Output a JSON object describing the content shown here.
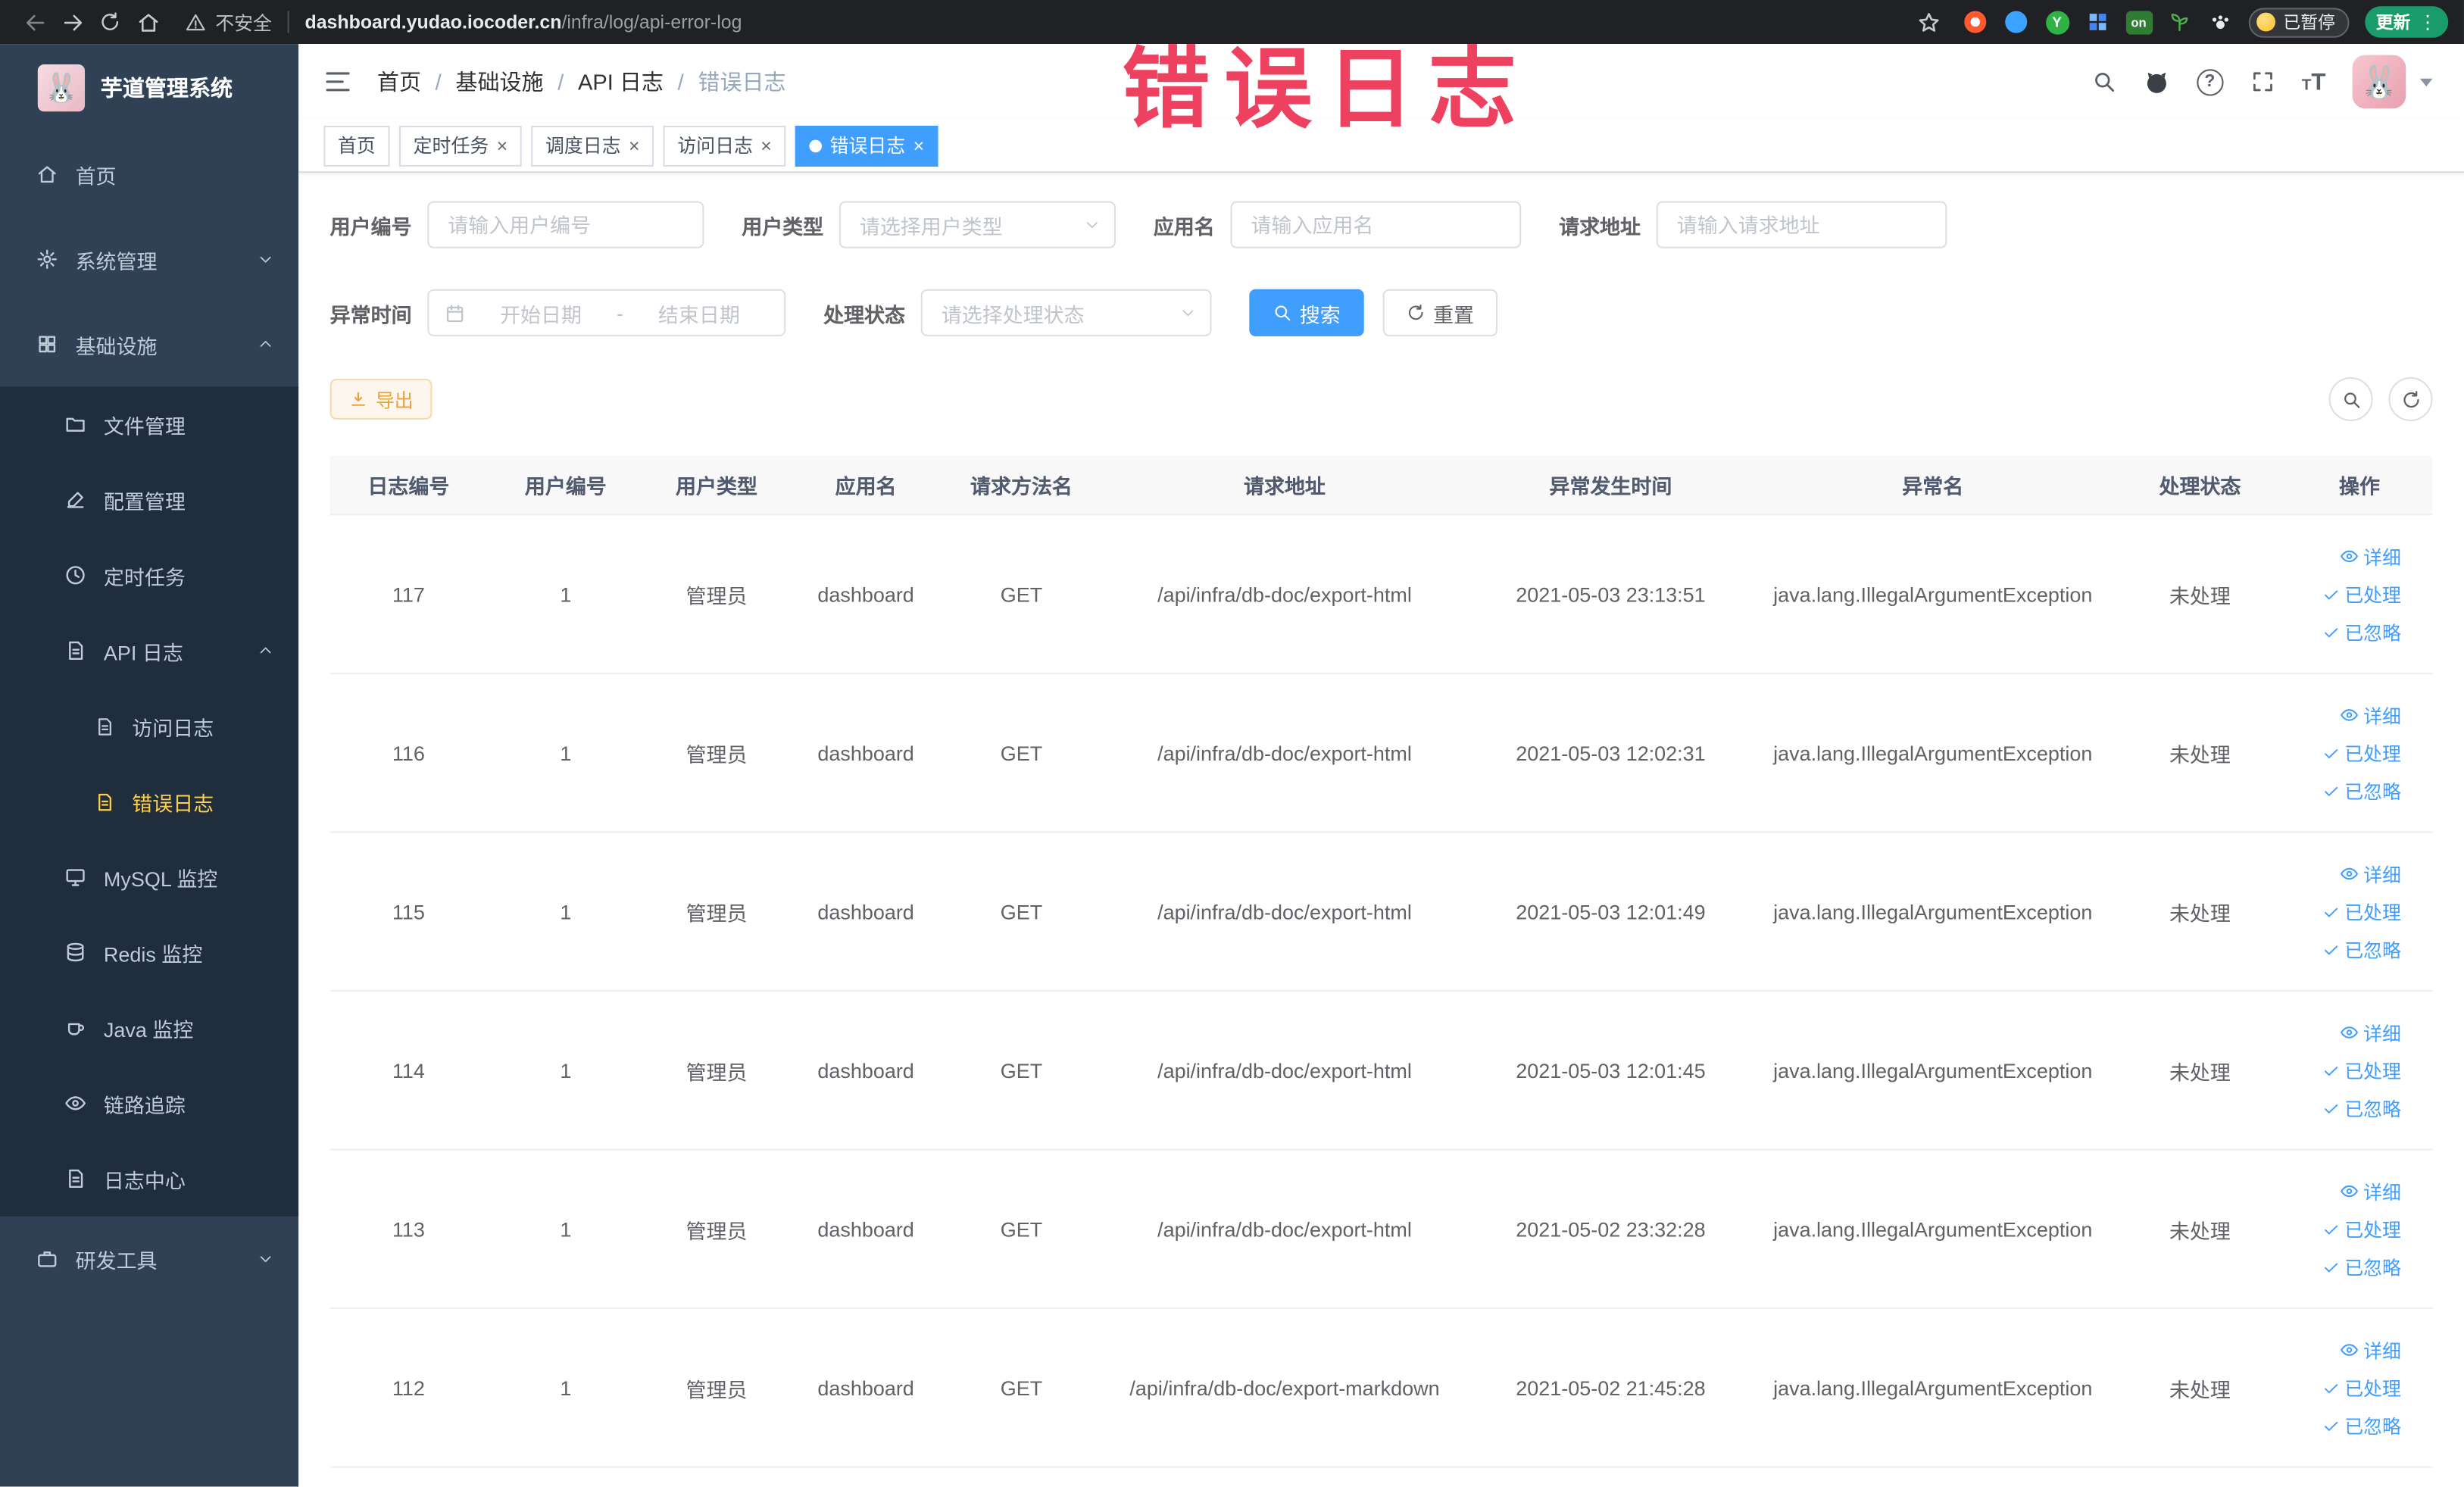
{
  "browser": {
    "security_label": "不安全",
    "url_host": "dashboard.yudao.iocoder.cn",
    "url_path": "/infra/log/api-error-log",
    "extension_y_badge": "Y",
    "extension_on_badge": "on",
    "paused_chip": "已暂停",
    "update_button": "更新"
  },
  "annotation": {
    "text": "错误日志",
    "color": "#ee4160"
  },
  "sidebar": {
    "title": "芋道管理系统",
    "items": [
      {
        "label": "首页"
      },
      {
        "label": "系统管理"
      },
      {
        "label": "基础设施"
      },
      {
        "label": "文件管理"
      },
      {
        "label": "配置管理"
      },
      {
        "label": "定时任务"
      },
      {
        "label": "API 日志"
      },
      {
        "label": "访问日志"
      },
      {
        "label": "错误日志"
      },
      {
        "label": "MySQL 监控"
      },
      {
        "label": "Redis 监控"
      },
      {
        "label": "Java 监控"
      },
      {
        "label": "链路追踪"
      },
      {
        "label": "日志中心"
      },
      {
        "label": "研发工具"
      }
    ]
  },
  "breadcrumb": [
    "首页",
    "基础设施",
    "API 日志",
    "错误日志"
  ],
  "tabs": [
    {
      "label": "首页"
    },
    {
      "label": "定时任务"
    },
    {
      "label": "调度日志"
    },
    {
      "label": "访问日志"
    },
    {
      "label": "错误日志"
    }
  ],
  "filters": {
    "user_id": {
      "label": "用户编号",
      "placeholder": "请输入用户编号"
    },
    "user_type": {
      "label": "用户类型",
      "placeholder": "请选择用户类型"
    },
    "app_name": {
      "label": "应用名",
      "placeholder": "请输入应用名"
    },
    "request_url": {
      "label": "请求地址",
      "placeholder": "请输入请求地址"
    },
    "exception_time": {
      "label": "异常时间",
      "start_placeholder": "开始日期",
      "separator": "-",
      "end_placeholder": "结束日期"
    },
    "process_status": {
      "label": "处理状态",
      "placeholder": "请选择处理状态"
    },
    "search_button": "搜索",
    "reset_button": "重置"
  },
  "toolbar": {
    "export_button": "导出"
  },
  "table": {
    "columns": [
      "日志编号",
      "用户编号",
      "用户类型",
      "应用名",
      "请求方法名",
      "请求地址",
      "异常发生时间",
      "异常名",
      "处理状态",
      "操作"
    ],
    "actions": {
      "detail": "详细",
      "processed": "已处理",
      "ignored": "已忽略"
    },
    "rows": [
      {
        "id": "117",
        "user_id": "1",
        "user_type": "管理员",
        "app_name": "dashboard",
        "method": "GET",
        "url": "/api/infra/db-doc/export-html",
        "time": "2021-05-03 23:13:51",
        "exception": "java.lang.IllegalArgumentException",
        "status": "未处理"
      },
      {
        "id": "116",
        "user_id": "1",
        "user_type": "管理员",
        "app_name": "dashboard",
        "method": "GET",
        "url": "/api/infra/db-doc/export-html",
        "time": "2021-05-03 12:02:31",
        "exception": "java.lang.IllegalArgumentException",
        "status": "未处理"
      },
      {
        "id": "115",
        "user_id": "1",
        "user_type": "管理员",
        "app_name": "dashboard",
        "method": "GET",
        "url": "/api/infra/db-doc/export-html",
        "time": "2021-05-03 12:01:49",
        "exception": "java.lang.IllegalArgumentException",
        "status": "未处理"
      },
      {
        "id": "114",
        "user_id": "1",
        "user_type": "管理员",
        "app_name": "dashboard",
        "method": "GET",
        "url": "/api/infra/db-doc/export-html",
        "time": "2021-05-03 12:01:45",
        "exception": "java.lang.IllegalArgumentException",
        "status": "未处理"
      },
      {
        "id": "113",
        "user_id": "1",
        "user_type": "管理员",
        "app_name": "dashboard",
        "method": "GET",
        "url": "/api/infra/db-doc/export-html",
        "time": "2021-05-02 23:32:28",
        "exception": "java.lang.IllegalArgumentException",
        "status": "未处理"
      },
      {
        "id": "112",
        "user_id": "1",
        "user_type": "管理员",
        "app_name": "dashboard",
        "method": "GET",
        "url": "/api/infra/db-doc/export-markdown",
        "time": "2021-05-02 21:45:28",
        "exception": "java.lang.IllegalArgumentException",
        "status": "未处理"
      }
    ]
  }
}
